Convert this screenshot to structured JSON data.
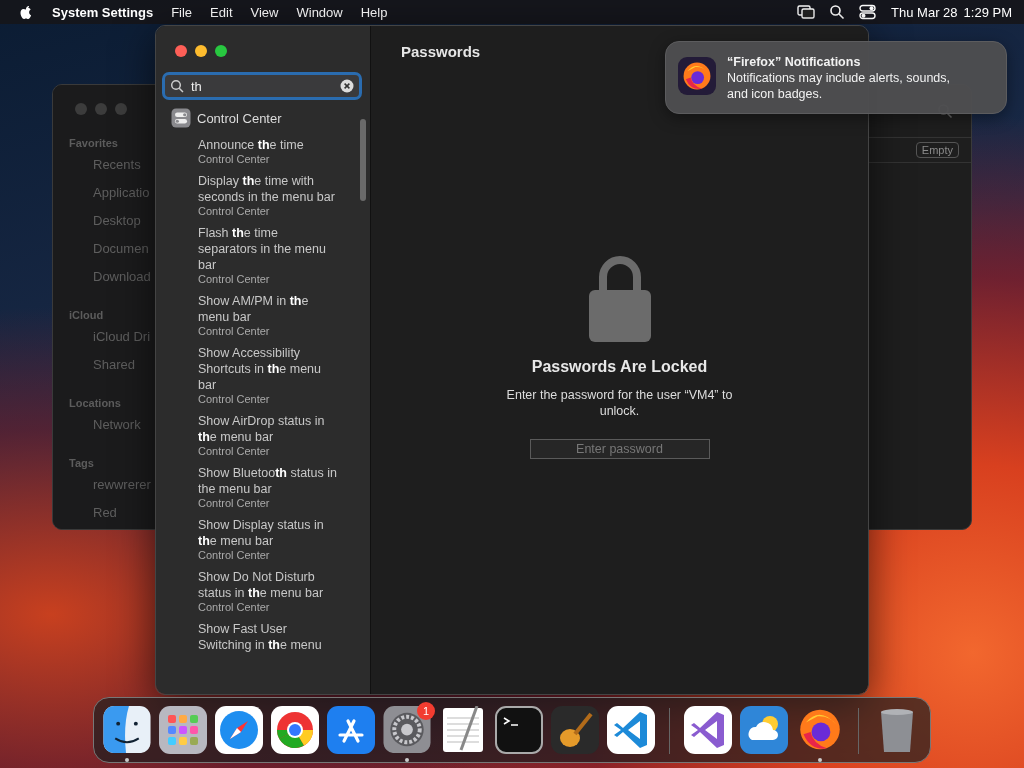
{
  "menu_bar": {
    "app_name": "System Settings",
    "menus": [
      "File",
      "Edit",
      "View",
      "Window",
      "Help"
    ],
    "date": "Thu Mar 28",
    "time": "1:29 PM"
  },
  "finder_window": {
    "sections": [
      {
        "heading": "Favorites",
        "items": [
          "Recents",
          "Applicatio",
          "Desktop",
          "Documen",
          "Download"
        ]
      },
      {
        "heading": "iCloud",
        "items": [
          "iCloud Dri",
          "Shared"
        ]
      },
      {
        "heading": "Locations",
        "items": [
          "Network"
        ]
      },
      {
        "heading": "Tags",
        "items": [
          "rewwrerer",
          "Red"
        ]
      }
    ],
    "badge": "Empty"
  },
  "settings_window": {
    "title": "Passwords",
    "search": {
      "value": "th"
    },
    "results": [
      {
        "kind": "group",
        "title": "Control Center"
      },
      {
        "kind": "setting",
        "title": "Announce **th**e time",
        "subtitle": "Control Center"
      },
      {
        "kind": "setting",
        "title": "Display **th**e time with seconds in the menu bar",
        "subtitle": "Control Center"
      },
      {
        "kind": "setting",
        "title": "Flash **th**e time separators in the menu bar",
        "subtitle": "Control Center"
      },
      {
        "kind": "setting",
        "title": "Show AM/PM in **th**e menu bar",
        "subtitle": "Control Center"
      },
      {
        "kind": "setting",
        "title": "Show Accessibility Shortcuts in **th**e menu bar",
        "subtitle": "Control Center"
      },
      {
        "kind": "setting",
        "title": "Show AirDrop status in **th**e menu bar",
        "subtitle": "Control Center"
      },
      {
        "kind": "setting",
        "title": "Show Bluetoo**th** status in the menu bar",
        "subtitle": "Control Center"
      },
      {
        "kind": "setting",
        "title": "Show Display status in **th**e menu bar",
        "subtitle": "Control Center"
      },
      {
        "kind": "setting",
        "title": "Show Do Not Disturb status in **th**e menu bar",
        "subtitle": "Control Center"
      },
      {
        "kind": "setting",
        "title": "Show Fast User Switching in **th**e menu"
      }
    ],
    "locked": {
      "heading": "Passwords Are Locked",
      "message": "Enter the password for the user “VM4” to unlock.",
      "password_field": {
        "placeholder": "Enter password"
      }
    }
  },
  "notification": {
    "title": "“Firefox” Notifications",
    "body": "Notifications may include alerts, sounds, and icon badges."
  },
  "dock": [
    {
      "kind": "finder",
      "running": true
    },
    {
      "kind": "launchpad",
      "running": false
    },
    {
      "kind": "safari",
      "running": false
    },
    {
      "kind": "chrome",
      "running": false
    },
    {
      "kind": "appstore",
      "running": false
    },
    {
      "kind": "settings",
      "running": true,
      "badge": "1"
    },
    {
      "kind": "textedit",
      "running": false
    },
    {
      "kind": "terminal",
      "running": false
    },
    {
      "kind": "garageband",
      "running": false
    },
    {
      "kind": "vscode",
      "running": false
    },
    {
      "kind": "separator"
    },
    {
      "kind": "visualstudio",
      "running": false
    },
    {
      "kind": "weather",
      "running": false
    },
    {
      "kind": "firefox",
      "running": true
    },
    {
      "kind": "separator"
    },
    {
      "kind": "trash",
      "running": false
    }
  ]
}
